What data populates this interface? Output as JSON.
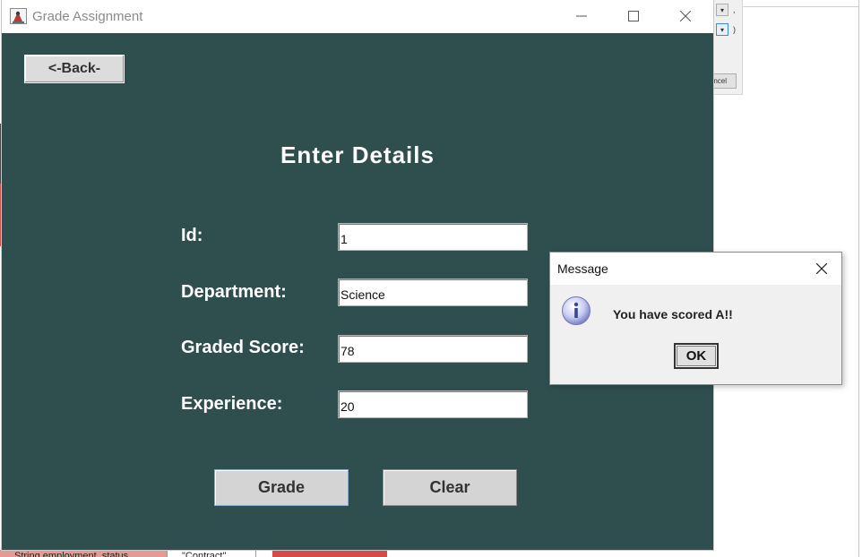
{
  "window": {
    "title": "Grade Assignment"
  },
  "form": {
    "back_label": "<-Back-",
    "heading": "Enter Details",
    "fields": [
      {
        "label": "Id:",
        "value": "1"
      },
      {
        "label": "Department:",
        "value": "Science"
      },
      {
        "label": "Graded Score:",
        "value": "78"
      },
      {
        "label": "Experience:",
        "value": "20"
      }
    ],
    "grade_label": "Grade",
    "clear_label": "Clear"
  },
  "dialog": {
    "title": "Message",
    "message": "You have scored A!!",
    "ok_label": "OK",
    "icon": "information-icon"
  },
  "background": {
    "cancel_fragment": "ncel",
    "bottom_cell_1": "String employment_status",
    "bottom_cell_2": "\"Contract\""
  },
  "colors": {
    "panel_background": "#2f4f4f",
    "label_text": "#ffffff",
    "info_icon": "#7a83c9"
  }
}
